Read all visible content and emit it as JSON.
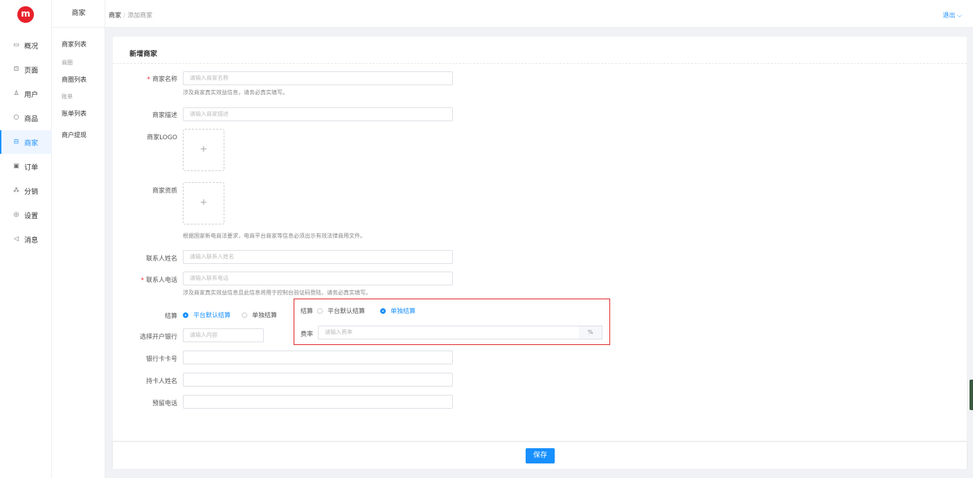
{
  "brand": {
    "logo_text": "m",
    "color": "#e8212b"
  },
  "accent": "#1890ff",
  "nav": {
    "items": [
      {
        "label": "概况",
        "icon": "dashboard-icon",
        "glyph": "▭"
      },
      {
        "label": "页面",
        "icon": "page-icon",
        "glyph": "⊡"
      },
      {
        "label": "用户",
        "icon": "user-icon",
        "glyph": "♙"
      },
      {
        "label": "商品",
        "icon": "goods-icon",
        "glyph": "⬡"
      },
      {
        "label": "商家",
        "icon": "merchant-icon",
        "glyph": "⊟",
        "active": true
      },
      {
        "label": "订单",
        "icon": "order-icon",
        "glyph": "▣"
      },
      {
        "label": "分销",
        "icon": "distribution-icon",
        "glyph": "⁂"
      },
      {
        "label": "设置",
        "icon": "settings-icon",
        "glyph": "◎"
      },
      {
        "label": "消息",
        "icon": "message-icon",
        "glyph": "◁"
      }
    ]
  },
  "subnav": {
    "title": "商家",
    "items": [
      {
        "label": "商家列表"
      },
      {
        "group": "商圈"
      },
      {
        "label": "商圈列表"
      },
      {
        "group": "账单"
      },
      {
        "label": "账单列表"
      },
      {
        "label": "商户提现"
      }
    ]
  },
  "topbar": {
    "crumb_root": "商家",
    "crumb_sep": "/",
    "crumb_current": "添加商家",
    "logout_label": "退出 ⌵"
  },
  "form": {
    "title": "新增商家",
    "required_mark": "*",
    "name": {
      "label": "商家名称",
      "placeholder": "请输入商家名称",
      "hint": "涉及商家真实效益信息，请务必真实填写。"
    },
    "desc": {
      "label": "商家描述",
      "placeholder": "请输入商家描述"
    },
    "logo": {
      "label": "商家LOGO",
      "plus": "+"
    },
    "qualification": {
      "label": "商家资质",
      "plus": "+",
      "hint": "根据国家新电商法要求，电商平台商家等信息必须出示有效法律商用文件。"
    },
    "contact_name": {
      "label": "联系人姓名",
      "placeholder": "请输入联系人姓名"
    },
    "contact_phone": {
      "label": "联系人电话",
      "placeholder": "请输入联系电话",
      "hint": "涉及商家真实效益信息且此信息将用于控制台验证码登陆，请务必真实填写。"
    },
    "settlement": {
      "label": "结算",
      "options": [
        "平台默认结算",
        "单独结算"
      ],
      "selected": "平台默认结算"
    },
    "bank": {
      "label": "选择开户银行",
      "placeholder": "请输入内容"
    },
    "card_no": {
      "label": "银行卡卡号",
      "placeholder": ""
    },
    "holder": {
      "label": "持卡人姓名",
      "placeholder": ""
    },
    "phone": {
      "label": "预留电话",
      "placeholder": ""
    }
  },
  "highlight": {
    "border_color": "#e02020",
    "settlement_label": "结算",
    "options": [
      "平台默认结算",
      "单独结算"
    ],
    "selected": "单独结算",
    "rate_label": "费率",
    "rate_placeholder": "请输入费率",
    "rate_suffix": "%"
  },
  "footer": {
    "save_label": "保存"
  }
}
